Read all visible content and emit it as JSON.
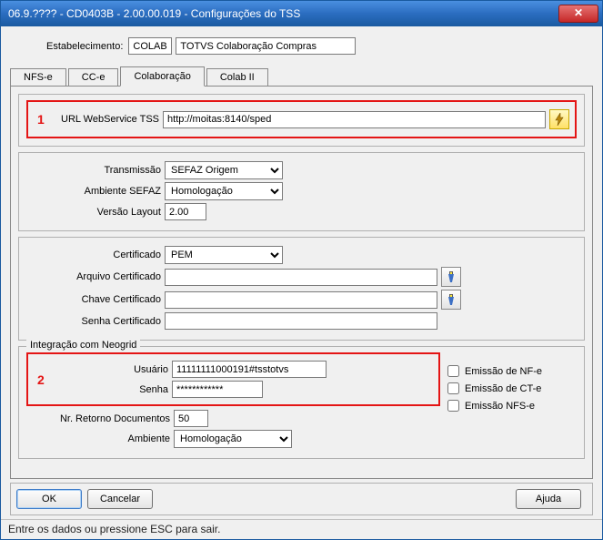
{
  "window": {
    "title": "06.9.???? - CD0403B - 2.00.00.019 - Configurações do TSS"
  },
  "header": {
    "estab_label": "Estabelecimento:",
    "estab_code": "COLAB",
    "estab_desc": "TOTVS Colaboração Compras"
  },
  "tabs": {
    "nfse": "NFS-e",
    "cce": "CC-e",
    "colab": "Colaboração",
    "colab2": "Colab II"
  },
  "annotations": {
    "one": "1",
    "two": "2"
  },
  "url_section": {
    "label": "URL WebService TSS",
    "value": "http://moitas:8140/sped"
  },
  "trans_section": {
    "transmissao_label": "Transmissão",
    "transmissao_value": "SEFAZ Origem",
    "ambiente_label": "Ambiente SEFAZ",
    "ambiente_value": "Homologação",
    "versao_label": "Versão Layout",
    "versao_value": "2.00"
  },
  "cert_section": {
    "certificado_label": "Certificado",
    "certificado_value": "PEM",
    "arquivo_label": "Arquivo Certificado",
    "arquivo_value": "",
    "chave_label": "Chave Certificado",
    "chave_value": "",
    "senha_label": "Senha Certificado",
    "senha_value": ""
  },
  "neogrid": {
    "title": "Integração com Neogrid",
    "usuario_label": "Usuário",
    "usuario_value": "11111111000191#tsstotvs",
    "senha_label": "Senha",
    "senha_value": "************",
    "nr_retorno_label": "Nr. Retorno Documentos",
    "nr_retorno_value": "50",
    "ambiente_label": "Ambiente",
    "ambiente_value": "Homologação",
    "chk_nfe": "Emissão de NF-e",
    "chk_cte": "Emissão de CT-e",
    "chk_nfse": "Emissão NFS-e"
  },
  "buttons": {
    "ok": "OK",
    "cancel": "Cancelar",
    "help": "Ajuda"
  },
  "statusbar": "Entre os dados ou pressione ESC para sair."
}
